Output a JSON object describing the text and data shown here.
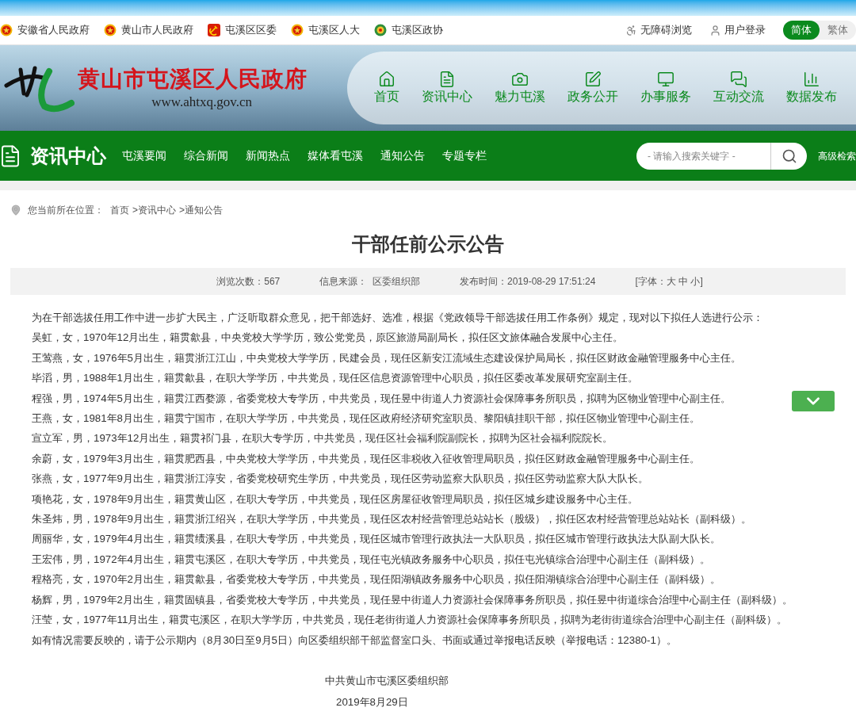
{
  "top_links": [
    {
      "label": "安徽省人民政府",
      "kind": "emblem"
    },
    {
      "label": "黄山市人民政府",
      "kind": "emblem"
    },
    {
      "label": "屯溪区区委",
      "kind": "party"
    },
    {
      "label": "屯溪区人大",
      "kind": "emblem"
    },
    {
      "label": "屯溪区政协",
      "kind": "cppcc"
    }
  ],
  "utility_links": [
    {
      "label": "无障碍浏览",
      "kind": "accessibility"
    },
    {
      "label": "用户登录",
      "kind": "user"
    }
  ],
  "language_toggle": [
    {
      "label": "简体",
      "selected": true
    },
    {
      "label": "繁体",
      "selected": false
    }
  ],
  "site": {
    "name": "黄山市屯溪区人民政府",
    "url": "www.ahtxq.gov.cn"
  },
  "main_nav": [
    {
      "label": "首页",
      "kind": "home"
    },
    {
      "label": "资讯中心",
      "kind": "doc"
    },
    {
      "label": "魅力屯溪",
      "kind": "camera"
    },
    {
      "label": "政务公开",
      "kind": "edit"
    },
    {
      "label": "办事服务",
      "kind": "monitor"
    },
    {
      "label": "互动交流",
      "kind": "chat"
    },
    {
      "label": "数据发布",
      "kind": "chart"
    }
  ],
  "section": {
    "title": "资讯中心",
    "tabs": [
      "屯溪要闻",
      "综合新闻",
      "新闻热点",
      "媒体看屯溪",
      "通知公告",
      "专题专栏"
    ]
  },
  "search": {
    "placeholder": "- 请输入搜索关键字 -",
    "advanced": "高级检索"
  },
  "breadcrumb": {
    "label": "您当前所在位置：",
    "items": [
      "首页",
      ">资讯中心",
      ">通知公告"
    ]
  },
  "article": {
    "title": "干部任前公示公告",
    "meta": [
      "浏览次数：567",
      "信息来源：  区委组织部",
      "发布时间：2019-08-29 17:51:24",
      "[字体：大 中 小]"
    ],
    "paragraphs": [
      "为在干部选拔任用工作中进一步扩大民主，广泛听取群众意见，把干部选好、选准，根据《党政领导干部选拔任用工作条例》规定，现对以下拟任人选进行公示：",
      "吴虹，女，1970年12月出生，籍贯歙县，中央党校大学学历，致公党党员，原区旅游局副局长，拟任区文旅体融合发展中心主任。",
      "王莺燕，女，1976年5月出生，籍贯浙江江山，中央党校大学学历，民建会员，现任区新安江流域生态建设保护局局长，拟任区财政金融管理服务中心主任。",
      "毕滔，男，1988年1月出生，籍贯歙县，在职大学学历，中共党员，现任区信息资源管理中心职员，拟任区委改革发展研究室副主任。",
      "程强，男，1974年5月出生，籍贯江西婺源，省委党校大专学历，中共党员，现任昱中街道人力资源社会保障事务所职员，拟聘为区物业管理中心副主任。",
      "王燕，女，1981年8月出生，籍贯宁国市，在职大学学历，中共党员，现任区政府经济研究室职员、黎阳镇挂职干部，拟任区物业管理中心副主任。",
      "宣立军，男，1973年12月出生，籍贯祁门县，在职大专学历，中共党员，现任区社会福利院副院长，拟聘为区社会福利院院长。",
      "余蔚，女，1979年3月出生，籍贯肥西县，中央党校大学学历，中共党员，现任区非税收入征收管理局职员，拟任区财政金融管理服务中心副主任。",
      "张燕，女，1977年9月出生，籍贯浙江淳安，省委党校研究生学历，中共党员，现任区劳动监察大队职员，拟任区劳动监察大队大队长。",
      "项艳花，女，1978年9月出生，籍贯黄山区，在职大专学历，中共党员，现任区房屋征收管理局职员，拟任区城乡建设服务中心主任。",
      "朱圣炜，男，1978年9月出生，籍贯浙江绍兴，在职大学学历，中共党员，现任区农村经营管理总站站长（股级），拟任区农村经营管理总站站长（副科级）。",
      "周丽华，女，1979年4月出生，籍贯绩溪县，在职大专学历，中共党员，现任区城市管理行政执法一大队职员，拟任区城市管理行政执法大队副大队长。",
      "王宏伟，男，1972年4月出生，籍贯屯溪区，在职大专学历，中共党员，现任屯光镇政务服务中心职员，拟任屯光镇综合治理中心副主任（副科级）。",
      "程格亮，女，1970年2月出生，籍贯歙县，省委党校大专学历，中共党员，现任阳湖镇政务服务中心职员，拟任阳湖镇综合治理中心副主任（副科级）。",
      "杨辉，男，1979年2月出生，籍贯固镇县，省委党校大专学历，中共党员，现任昱中街道人力资源社会保障事务所职员，拟任昱中街道综合治理中心副主任（副科级）。",
      "汪莹，女，1977年11月出生，籍贯屯溪区，在职大学学历，中共党员，现任老街街道人力资源社会保障事务所职员，拟聘为老街街道综合治理中心副主任（副科级）。",
      "如有情况需要反映的，请于公示期内（8月30日至9月5日）向区委组织部干部监督室口头、书面或通过举报电话反映（举报电话：12380-1）。"
    ],
    "signature": [
      "中共黄山市屯溪区委组织部",
      "2019年8月29日"
    ]
  }
}
